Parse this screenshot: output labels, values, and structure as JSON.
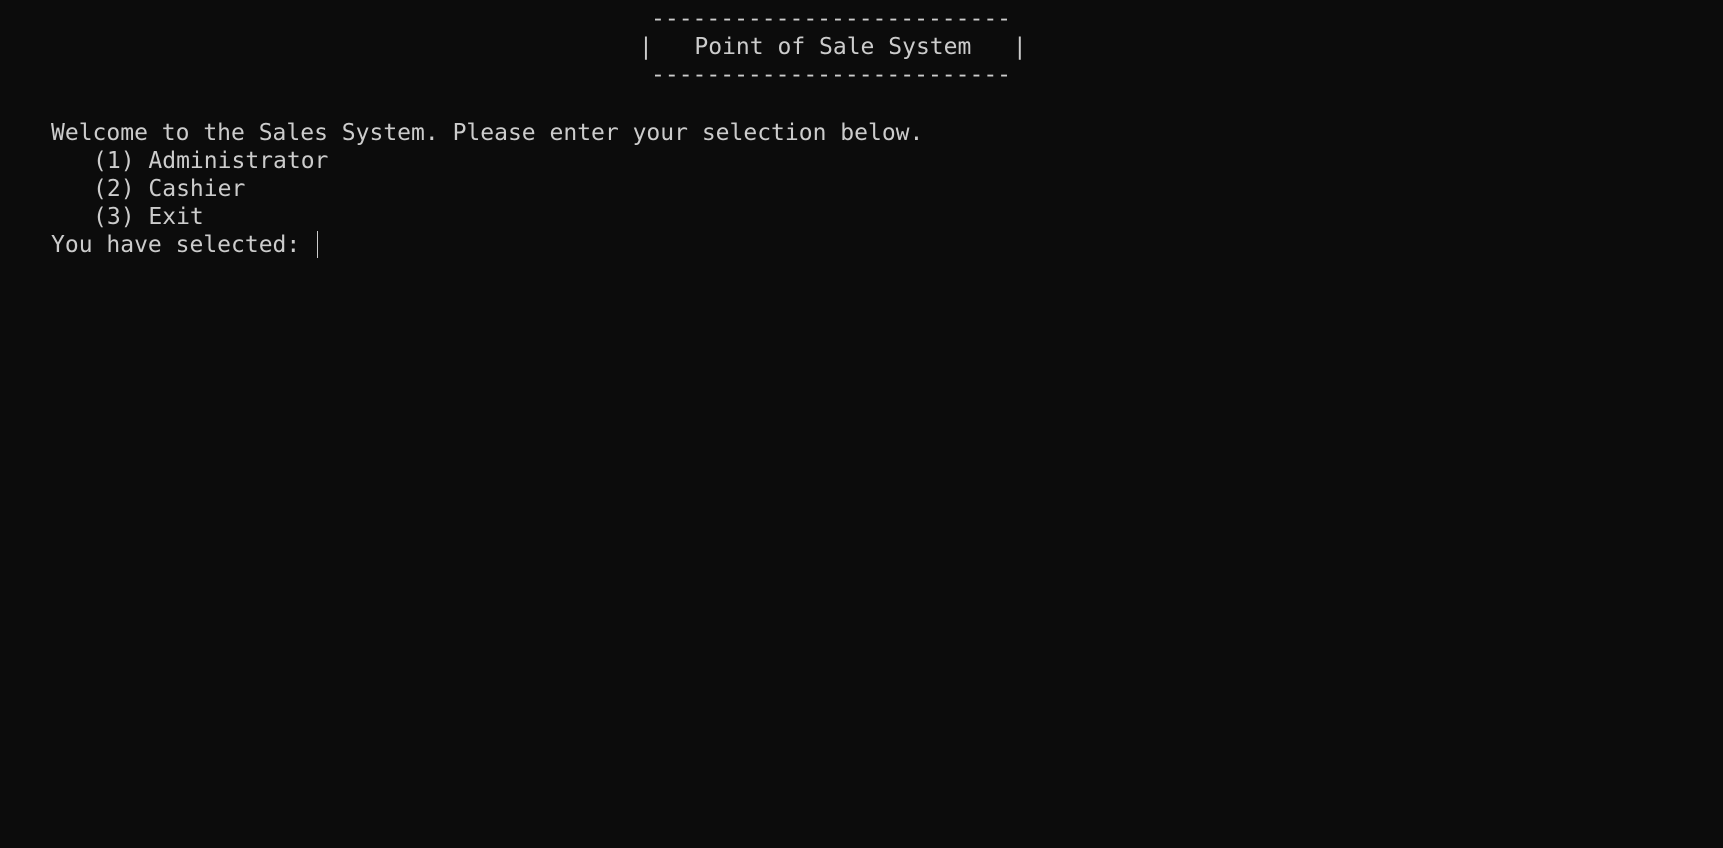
{
  "terminal": {
    "banner_top": "--------------------------",
    "banner_title_line": "|   Point of Sale System   |",
    "banner_bottom": "--------------------------",
    "welcome": "Welcome to the Sales System. Please enter your selection below.",
    "options": [
      {
        "label": "(1) Administrator"
      },
      {
        "label": "(2) Cashier"
      },
      {
        "label": "(3) Exit"
      }
    ],
    "prompt": "You have selected:",
    "input_value": ""
  },
  "colors": {
    "background": "#0c0c0c",
    "foreground": "#cccccc"
  }
}
